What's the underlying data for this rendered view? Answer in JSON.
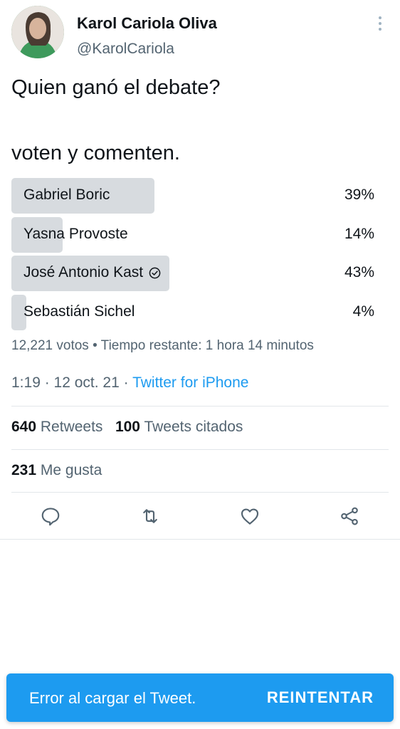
{
  "tweet": {
    "author": {
      "name": "Karol Cariola Oliva",
      "handle": "@KarolCariola"
    },
    "text_line1": "Quien ganó el debate?",
    "text_line2": "voten y comenten.",
    "poll": {
      "options": [
        {
          "label": "Gabriel Boric",
          "percent_text": "39%",
          "percent": 39,
          "selected": false
        },
        {
          "label": "Yasna Provoste",
          "percent_text": "14%",
          "percent": 14,
          "selected": false
        },
        {
          "label": "José Antonio Kast",
          "percent_text": "43%",
          "percent": 43,
          "selected": true
        },
        {
          "label": "Sebastián Sichel",
          "percent_text": "4%",
          "percent": 4,
          "selected": false
        }
      ],
      "meta": "12,221 votos • Tiempo restante: 1 hora 14 minutos"
    },
    "timestamp": "1:19 · 12 oct. 21 · ",
    "source": "Twitter for iPhone",
    "stats": {
      "retweets_count": "640",
      "retweets_label": "Retweets",
      "quotes_count": "100",
      "quotes_label": "Tweets citados",
      "likes_count": "231",
      "likes_label": "Me gusta"
    }
  },
  "icons": [
    "more-vertical-icon",
    "check-circle-icon",
    "reply-icon",
    "retweet-icon",
    "like-icon",
    "share-icon"
  ],
  "toast": {
    "message": "Error al cargar el Tweet.",
    "action": "REINTENTAR"
  },
  "colors": {
    "accent": "#1d9bf0",
    "secondary_text": "#536471",
    "poll_bar": "#d7dbdf",
    "primary_text": "#0f1419"
  }
}
